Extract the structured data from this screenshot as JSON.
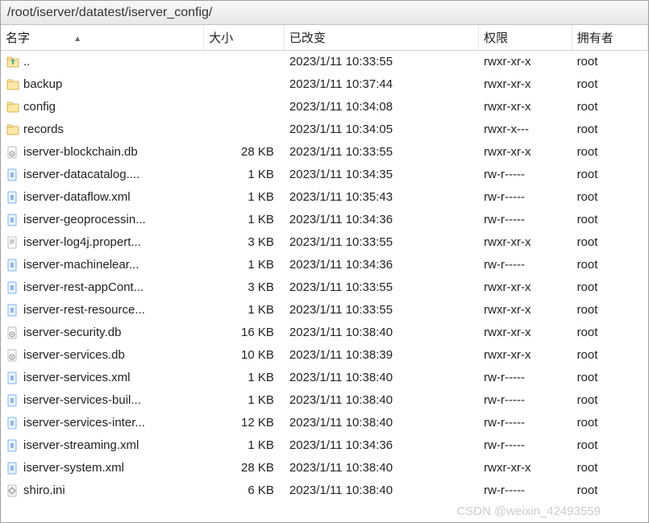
{
  "path": "/root/iserver/datatest/iserver_config/",
  "columns": {
    "name": "名字",
    "size": "大小",
    "changed": "已改变",
    "perm": "权限",
    "owner": "拥有者"
  },
  "rows": [
    {
      "icon": "updir",
      "name": "..",
      "size": "",
      "changed": "2023/1/11 10:33:55",
      "perm": "rwxr-xr-x",
      "owner": "root"
    },
    {
      "icon": "folder",
      "name": "backup",
      "size": "",
      "changed": "2023/1/11 10:37:44",
      "perm": "rwxr-xr-x",
      "owner": "root"
    },
    {
      "icon": "folder",
      "name": "config",
      "size": "",
      "changed": "2023/1/11 10:34:08",
      "perm": "rwxr-xr-x",
      "owner": "root"
    },
    {
      "icon": "folder",
      "name": "records",
      "size": "",
      "changed": "2023/1/11 10:34:05",
      "perm": "rwxr-x---",
      "owner": "root"
    },
    {
      "icon": "db",
      "name": "iserver-blockchain.db",
      "size": "28 KB",
      "changed": "2023/1/11 10:33:55",
      "perm": "rwxr-xr-x",
      "owner": "root"
    },
    {
      "icon": "xml",
      "name": "iserver-datacatalog....",
      "size": "1 KB",
      "changed": "2023/1/11 10:34:35",
      "perm": "rw-r-----",
      "owner": "root"
    },
    {
      "icon": "xml",
      "name": "iserver-dataflow.xml",
      "size": "1 KB",
      "changed": "2023/1/11 10:35:43",
      "perm": "rw-r-----",
      "owner": "root"
    },
    {
      "icon": "xml",
      "name": "iserver-geoprocessin...",
      "size": "1 KB",
      "changed": "2023/1/11 10:34:36",
      "perm": "rw-r-----",
      "owner": "root"
    },
    {
      "icon": "txt",
      "name": "iserver-log4j.propert...",
      "size": "3 KB",
      "changed": "2023/1/11 10:33:55",
      "perm": "rwxr-xr-x",
      "owner": "root"
    },
    {
      "icon": "xml",
      "name": "iserver-machinelear...",
      "size": "1 KB",
      "changed": "2023/1/11 10:34:36",
      "perm": "rw-r-----",
      "owner": "root"
    },
    {
      "icon": "xml",
      "name": "iserver-rest-appCont...",
      "size": "3 KB",
      "changed": "2023/1/11 10:33:55",
      "perm": "rwxr-xr-x",
      "owner": "root"
    },
    {
      "icon": "xml",
      "name": "iserver-rest-resource...",
      "size": "1 KB",
      "changed": "2023/1/11 10:33:55",
      "perm": "rwxr-xr-x",
      "owner": "root"
    },
    {
      "icon": "db",
      "name": "iserver-security.db",
      "size": "16 KB",
      "changed": "2023/1/11 10:38:40",
      "perm": "rwxr-xr-x",
      "owner": "root"
    },
    {
      "icon": "db",
      "name": "iserver-services.db",
      "size": "10 KB",
      "changed": "2023/1/11 10:38:39",
      "perm": "rwxr-xr-x",
      "owner": "root"
    },
    {
      "icon": "xml",
      "name": "iserver-services.xml",
      "size": "1 KB",
      "changed": "2023/1/11 10:38:40",
      "perm": "rw-r-----",
      "owner": "root"
    },
    {
      "icon": "xml",
      "name": "iserver-services-buil...",
      "size": "1 KB",
      "changed": "2023/1/11 10:38:40",
      "perm": "rw-r-----",
      "owner": "root"
    },
    {
      "icon": "xml",
      "name": "iserver-services-inter...",
      "size": "12 KB",
      "changed": "2023/1/11 10:38:40",
      "perm": "rw-r-----",
      "owner": "root"
    },
    {
      "icon": "xml",
      "name": "iserver-streaming.xml",
      "size": "1 KB",
      "changed": "2023/1/11 10:34:36",
      "perm": "rw-r-----",
      "owner": "root"
    },
    {
      "icon": "xml",
      "name": "iserver-system.xml",
      "size": "28 KB",
      "changed": "2023/1/11 10:38:40",
      "perm": "rwxr-xr-x",
      "owner": "root"
    },
    {
      "icon": "ini",
      "name": "shiro.ini",
      "size": "6 KB",
      "changed": "2023/1/11 10:38:40",
      "perm": "rw-r-----",
      "owner": "root"
    }
  ],
  "watermark": "CSDN @weixin_42493559"
}
